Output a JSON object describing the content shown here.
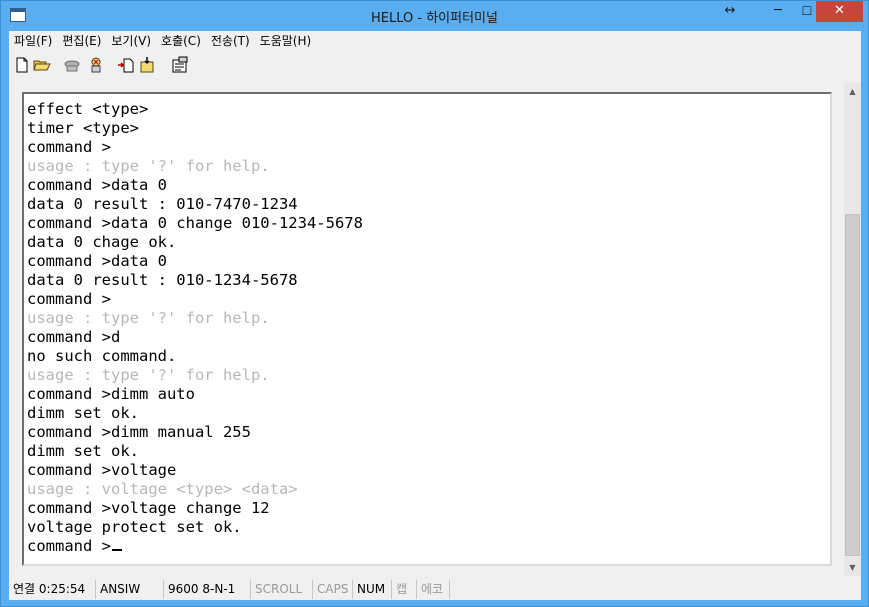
{
  "window": {
    "title": "HELLO - 하이퍼터미널",
    "buttons": {
      "resize": "↔",
      "minimize": "─",
      "maximize": "☐",
      "close": "✕"
    }
  },
  "menu": {
    "items": [
      {
        "label": "파일(F)"
      },
      {
        "label": "편집(E)"
      },
      {
        "label": "보기(V)"
      },
      {
        "label": "호출(C)"
      },
      {
        "label": "전송(T)"
      },
      {
        "label": "도움말(H)"
      }
    ]
  },
  "toolbar": {
    "icons": [
      "new-document-icon",
      "open-folder-icon",
      "connect-phone-icon",
      "disconnect-phone-icon",
      "send-file-icon",
      "receive-file-icon",
      "properties-icon"
    ]
  },
  "terminal": {
    "lines": [
      {
        "text": "effect <type>",
        "hint": false
      },
      {
        "text": "timer <type>",
        "hint": false
      },
      {
        "text": "command >",
        "hint": false
      },
      {
        "text": "usage : type '?' for help.",
        "hint": true
      },
      {
        "text": "command >data 0",
        "hint": false
      },
      {
        "text": "data 0 result : 010-7470-1234",
        "hint": false
      },
      {
        "text": "command >data 0 change 010-1234-5678",
        "hint": false
      },
      {
        "text": "data 0 chage ok.",
        "hint": false
      },
      {
        "text": "command >data 0",
        "hint": false
      },
      {
        "text": "data 0 result : 010-1234-5678",
        "hint": false
      },
      {
        "text": "command >",
        "hint": false
      },
      {
        "text": "usage : type '?' for help.",
        "hint": true
      },
      {
        "text": "command >d",
        "hint": false
      },
      {
        "text": "no such command.",
        "hint": false
      },
      {
        "text": "usage : type '?' for help.",
        "hint": true
      },
      {
        "text": "command >dimm auto",
        "hint": false
      },
      {
        "text": "dimm set ok.",
        "hint": false
      },
      {
        "text": "command >dimm manual 255",
        "hint": false
      },
      {
        "text": "dimm set ok.",
        "hint": false
      },
      {
        "text": "command >voltage",
        "hint": false
      },
      {
        "text": "usage : voltage <type> <data>",
        "hint": true
      },
      {
        "text": "command >voltage change 12",
        "hint": false
      },
      {
        "text": "voltage protect set ok.",
        "hint": false
      },
      {
        "text": "command >",
        "hint": false,
        "cursor": true
      }
    ]
  },
  "scrollbar": {
    "up": "▲",
    "down": "▼"
  },
  "status": {
    "cells": [
      {
        "text": "연결 0:25:54",
        "dim": false
      },
      {
        "text": "ANSIW",
        "dim": false
      },
      {
        "text": "9600 8-N-1",
        "dim": false
      },
      {
        "text": "SCROLL",
        "dim": true
      },
      {
        "text": "CAPS",
        "dim": true
      },
      {
        "text": "NUM",
        "dim": false
      },
      {
        "text": "캡",
        "dim": true
      },
      {
        "text": "에코",
        "dim": true
      }
    ]
  },
  "colors": {
    "titlebar": "#5aaef0",
    "close": "#c7463c",
    "hint_text": "#b8b8b8"
  }
}
